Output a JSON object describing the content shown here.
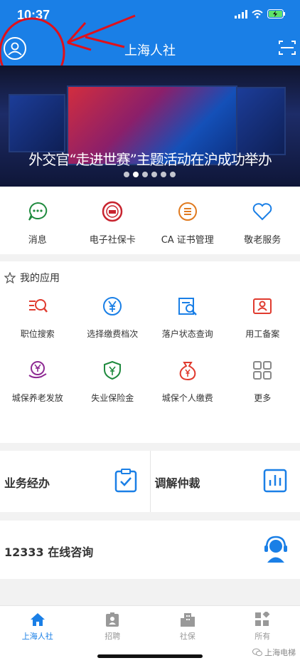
{
  "status_bar": {
    "time": "10:37"
  },
  "header": {
    "title": "上海人社"
  },
  "banner": {
    "caption": "外交官“走进世赛”主题活动在沪成功举办",
    "slide_count": 6,
    "active_slide": 1
  },
  "quick_actions": [
    {
      "label": "消息",
      "icon": "chat-icon"
    },
    {
      "label": "电子社保卡",
      "icon": "social-card-icon"
    },
    {
      "label": "CA 证书管理",
      "icon": "certificate-icon"
    },
    {
      "label": "敬老服务",
      "icon": "heart-icon"
    }
  ],
  "my_apps": {
    "title": "我的应用",
    "items": [
      {
        "label": "职位搜索",
        "icon": "job-search-icon"
      },
      {
        "label": "选择缴费档次",
        "icon": "yuan-icon"
      },
      {
        "label": "落户状态查询",
        "icon": "document-search-icon"
      },
      {
        "label": "用工备案",
        "icon": "employment-record-icon"
      },
      {
        "label": "城保养老发放",
        "icon": "pension-icon"
      },
      {
        "label": "失业保险金",
        "icon": "insurance-shield-icon"
      },
      {
        "label": "城保个人缴费",
        "icon": "money-bag-icon"
      },
      {
        "label": "更多",
        "icon": "grid-icon"
      }
    ]
  },
  "services": [
    {
      "label": "业务经办",
      "icon": "clipboard-check-icon"
    },
    {
      "label": "调解仲裁",
      "icon": "bar-chart-icon"
    }
  ],
  "consult": {
    "label": "12333 在线咨询",
    "icon": "headset-icon"
  },
  "tabs": [
    {
      "label": "上海人社",
      "icon": "home-icon",
      "active": true
    },
    {
      "label": "招聘",
      "icon": "badge-icon",
      "active": false
    },
    {
      "label": "社保",
      "icon": "building-icon",
      "active": false
    },
    {
      "label": "所有",
      "icon": "apps-icon",
      "active": false
    }
  ],
  "watermark": "上海电梯",
  "colors": {
    "primary": "#1a7fe6",
    "accent_red": "#e03b2f",
    "green": "#1f8a3e",
    "purple": "#8e2a93",
    "orange": "#e07a1f"
  }
}
